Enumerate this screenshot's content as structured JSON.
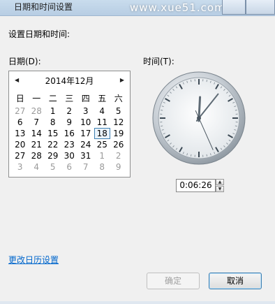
{
  "window": {
    "title": "日期和时间设置",
    "watermark": "www.xue51.com"
  },
  "heading": "设置日期和时间:",
  "date_label": "日期(D):",
  "time_label": "时间(T):",
  "calendar": {
    "month_label": "2014年12月",
    "weekdays": [
      "日",
      "一",
      "二",
      "三",
      "四",
      "五",
      "六"
    ],
    "weeks": [
      [
        {
          "d": "27",
          "o": true
        },
        {
          "d": "28",
          "o": true
        },
        {
          "d": "1"
        },
        {
          "d": "2"
        },
        {
          "d": "3"
        },
        {
          "d": "4"
        },
        {
          "d": "5"
        }
      ],
      [
        {
          "d": "6"
        },
        {
          "d": "7"
        },
        {
          "d": "8"
        },
        {
          "d": "9"
        },
        {
          "d": "10"
        },
        {
          "d": "11"
        },
        {
          "d": "12"
        }
      ],
      [
        {
          "d": "13"
        },
        {
          "d": "14"
        },
        {
          "d": "15"
        },
        {
          "d": "16"
        },
        {
          "d": "17"
        },
        {
          "d": "18",
          "sel": true
        },
        {
          "d": "19"
        }
      ],
      [
        {
          "d": "20"
        },
        {
          "d": "21"
        },
        {
          "d": "22"
        },
        {
          "d": "23"
        },
        {
          "d": "24"
        },
        {
          "d": "25"
        },
        {
          "d": "26"
        }
      ],
      [
        {
          "d": "27"
        },
        {
          "d": "28"
        },
        {
          "d": "29"
        },
        {
          "d": "30"
        },
        {
          "d": "31"
        },
        {
          "d": "1",
          "o": true
        },
        {
          "d": "2",
          "o": true
        }
      ],
      [
        {
          "d": "3",
          "o": true
        },
        {
          "d": "4",
          "o": true
        },
        {
          "d": "5",
          "o": true
        },
        {
          "d": "6",
          "o": true
        },
        {
          "d": "7",
          "o": true
        },
        {
          "d": "8",
          "o": true
        },
        {
          "d": "9",
          "o": true
        }
      ]
    ]
  },
  "clock": {
    "hour": 0,
    "minute": 6,
    "second": 26
  },
  "time_value": "0:06:26",
  "change_calendar_link": "更改日历设置",
  "ok_button": "确定",
  "cancel_button": "取消"
}
